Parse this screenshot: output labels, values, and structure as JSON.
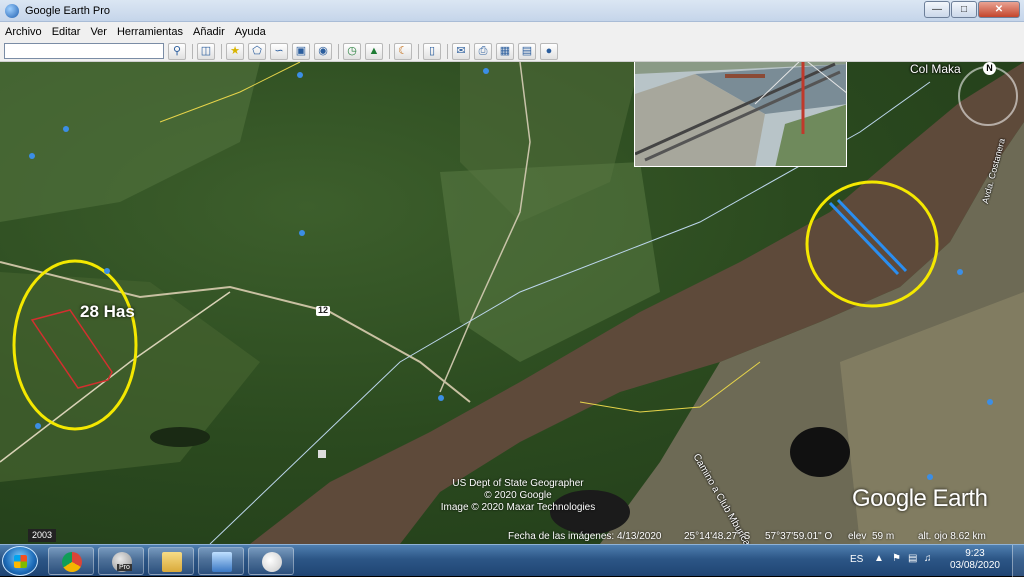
{
  "window": {
    "title": "Google Earth Pro"
  },
  "menu": [
    "Archivo",
    "Editar",
    "Ver",
    "Herramientas",
    "Añadir",
    "Ayuda"
  ],
  "map": {
    "place_label": "Col Maka",
    "area_label": "28 Has",
    "road_number": "12",
    "road_label": "Camino a Club Mburica",
    "street_label": "Avda. Costanera",
    "credits": [
      "US Dept of State Geographer",
      "© 2020 Google",
      "Image © 2020 Maxar Technologies"
    ],
    "logo": "Google Earth",
    "imagery_date": "Fecha de las imágenes: 4/13/2020",
    "lat": "25°14'48.27\" S",
    "lon": "57°37'59.01\" O",
    "elev_label": "elev",
    "elev_value": "59 m",
    "eye_alt": "alt. ojo 8.62 km",
    "year": "2003"
  },
  "taskbar": {
    "apps": [
      "chrome",
      "google-earth-pro",
      "file-explorer",
      "window",
      "paint"
    ],
    "pro_badge": "Pro",
    "lang": "ES",
    "time": "9:23",
    "date": "03/08/2020"
  },
  "colors": {
    "highlight_circle": "#f4e800",
    "plot_outline": "#d32f2f",
    "bridge": "#2a8ef0"
  }
}
